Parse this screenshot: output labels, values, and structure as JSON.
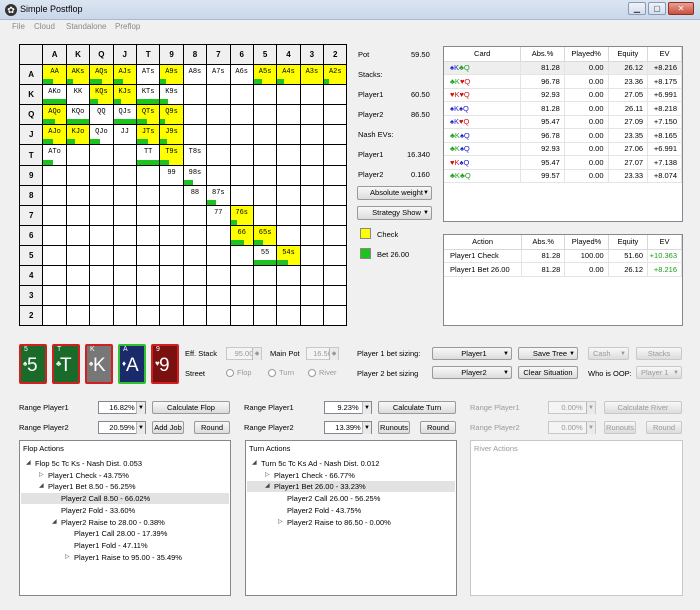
{
  "window": {
    "title": "Simple Postflop"
  },
  "menu": [
    "File",
    "Cloud",
    "Standalone",
    "Preflop"
  ],
  "ranks": [
    "A",
    "K",
    "Q",
    "J",
    "T",
    "9",
    "8",
    "7",
    "6",
    "5",
    "4",
    "3",
    "2"
  ],
  "cells": [
    {
      "r": 0,
      "c": 0,
      "t": "AA",
      "y": 1,
      "g": 0.45
    },
    {
      "r": 0,
      "c": 1,
      "t": "AKs",
      "y": 1,
      "g": 0.3
    },
    {
      "r": 0,
      "c": 2,
      "t": "AQs",
      "y": 1,
      "g": 0.55
    },
    {
      "r": 0,
      "c": 3,
      "t": "AJs",
      "y": 1,
      "g": 0.4
    },
    {
      "r": 0,
      "c": 4,
      "t": "ATs",
      "y": 0,
      "g": 0
    },
    {
      "r": 0,
      "c": 5,
      "t": "A9s",
      "y": 1,
      "g": 0.25
    },
    {
      "r": 0,
      "c": 6,
      "t": "A8s",
      "y": 0,
      "g": 0
    },
    {
      "r": 0,
      "c": 7,
      "t": "A7s",
      "y": 0,
      "g": 0
    },
    {
      "r": 0,
      "c": 8,
      "t": "A6s",
      "y": 0,
      "g": 0
    },
    {
      "r": 0,
      "c": 9,
      "t": "A5s",
      "y": 1,
      "g": 0.35
    },
    {
      "r": 0,
      "c": 10,
      "t": "A4s",
      "y": 1,
      "g": 0.3
    },
    {
      "r": 0,
      "c": 11,
      "t": "A3s",
      "y": 1,
      "g": 0
    },
    {
      "r": 0,
      "c": 12,
      "t": "A2s",
      "y": 1,
      "g": 0.2
    },
    {
      "r": 1,
      "c": 0,
      "t": "AKo",
      "y": 0,
      "g": 1
    },
    {
      "r": 1,
      "c": 1,
      "t": "KK",
      "y": 0,
      "g": 0
    },
    {
      "r": 1,
      "c": 2,
      "t": "KQs",
      "y": 1,
      "g": 0.35
    },
    {
      "r": 1,
      "c": 3,
      "t": "KJs",
      "y": 1,
      "g": 0.35
    },
    {
      "r": 1,
      "c": 4,
      "t": "KTs",
      "y": 0,
      "g": 1
    },
    {
      "r": 1,
      "c": 5,
      "t": "K9s",
      "y": 0,
      "g": 0.35
    },
    {
      "r": 2,
      "c": 0,
      "t": "AQo",
      "y": 1,
      "g": 0.5
    },
    {
      "r": 2,
      "c": 1,
      "t": "KQo",
      "y": 0,
      "g": 1
    },
    {
      "r": 2,
      "c": 2,
      "t": "QQ",
      "y": 0,
      "g": 0
    },
    {
      "r": 2,
      "c": 3,
      "t": "QJs",
      "y": 0,
      "g": 1
    },
    {
      "r": 2,
      "c": 4,
      "t": "QTs",
      "y": 1,
      "g": 0.45
    },
    {
      "r": 2,
      "c": 5,
      "t": "Q9s",
      "y": 1,
      "g": 0.2
    },
    {
      "r": 3,
      "c": 0,
      "t": "AJo",
      "y": 1,
      "g": 0.45
    },
    {
      "r": 3,
      "c": 1,
      "t": "KJo",
      "y": 1,
      "g": 0.35
    },
    {
      "r": 3,
      "c": 2,
      "t": "QJo",
      "y": 0,
      "g": 0.45
    },
    {
      "r": 3,
      "c": 3,
      "t": "JJ",
      "y": 0,
      "g": 0
    },
    {
      "r": 3,
      "c": 4,
      "t": "JTs",
      "y": 1,
      "g": 0.5
    },
    {
      "r": 3,
      "c": 5,
      "t": "J9s",
      "y": 1,
      "g": 0.3
    },
    {
      "r": 4,
      "c": 0,
      "t": "ATo",
      "y": 0,
      "g": 0.45
    },
    {
      "r": 4,
      "c": 4,
      "t": "TT",
      "y": 0,
      "g": 1
    },
    {
      "r": 4,
      "c": 5,
      "t": "T9s",
      "y": 1,
      "g": 0.4
    },
    {
      "r": 4,
      "c": 6,
      "t": "T8s",
      "y": 0,
      "g": 0
    },
    {
      "r": 5,
      "c": 5,
      "t": "99",
      "y": 0,
      "g": 0
    },
    {
      "r": 5,
      "c": 6,
      "t": "98s",
      "y": 0,
      "g": 0.4
    },
    {
      "r": 6,
      "c": 6,
      "t": "88",
      "y": 0,
      "g": 0
    },
    {
      "r": 6,
      "c": 7,
      "t": "87s",
      "y": 0,
      "g": 0.4
    },
    {
      "r": 7,
      "c": 7,
      "t": "77",
      "y": 0,
      "g": 0
    },
    {
      "r": 7,
      "c": 8,
      "t": "76s",
      "y": 1,
      "g": 0.3
    },
    {
      "r": 8,
      "c": 8,
      "t": "66",
      "y": 1,
      "g": 0.6
    },
    {
      "r": 8,
      "c": 9,
      "t": "65s",
      "y": 1,
      "g": 0.4
    },
    {
      "r": 9,
      "c": 9,
      "t": "55",
      "y": 0,
      "g": 1
    },
    {
      "r": 9,
      "c": 10,
      "t": "54s",
      "y": 1,
      "g": 0.5
    }
  ],
  "info": {
    "pot_label": "Pot",
    "pot_value": "59.50",
    "stacks_label": "Stacks:",
    "player1_label": "Player1",
    "player1_stack": "60.50",
    "player2_label": "Player2",
    "player2_stack": "86.50",
    "nash_label": "Nash EVs:",
    "player1_ev": "16.340",
    "player2_ev": "0.160",
    "weight_select": "Absolute weight",
    "strategy_select": "Strategy Show",
    "check_legend": "Check",
    "bet_legend": "Bet 26.00",
    "colors": {
      "check": "#ffff00",
      "bet": "#1ec41e"
    }
  },
  "card_table": {
    "headers": [
      "Card",
      "Abs.%",
      "Played%",
      "Equity",
      "EV"
    ],
    "rows": [
      {
        "s1": "♠",
        "c1": "#1a1acc",
        "r1": "K",
        "s2": "♣",
        "c2": "#20a020",
        "r2": "Q",
        "abs": "81.28",
        "played": "0.00",
        "equity": "26.12",
        "ev": "+8.216"
      },
      {
        "s1": "♣",
        "c1": "#20a020",
        "r1": "K",
        "s2": "♥",
        "c2": "#d01010",
        "r2": "Q",
        "abs": "96.78",
        "played": "0.00",
        "equity": "23.36",
        "ev": "+8.175"
      },
      {
        "s1": "♥",
        "c1": "#d01010",
        "r1": "K",
        "s2": "♥",
        "c2": "#d01010",
        "r2": "Q",
        "abs": "92.93",
        "played": "0.00",
        "equity": "27.05",
        "ev": "+6.991"
      },
      {
        "s1": "♠",
        "c1": "#1a1acc",
        "r1": "K",
        "s2": "♠",
        "c2": "#1a1acc",
        "r2": "Q",
        "abs": "81.28",
        "played": "0.00",
        "equity": "26.11",
        "ev": "+8.218"
      },
      {
        "s1": "♠",
        "c1": "#1a1acc",
        "r1": "K",
        "s2": "♥",
        "c2": "#d01010",
        "r2": "Q",
        "abs": "95.47",
        "played": "0.00",
        "equity": "27.09",
        "ev": "+7.150"
      },
      {
        "s1": "♣",
        "c1": "#20a020",
        "r1": "K",
        "s2": "♠",
        "c2": "#1a1acc",
        "r2": "Q",
        "abs": "96.78",
        "played": "0.00",
        "equity": "23.35",
        "ev": "+8.165"
      },
      {
        "s1": "♣",
        "c1": "#20a020",
        "r1": "K",
        "s2": "♠",
        "c2": "#1a1acc",
        "r2": "Q",
        "abs": "92.93",
        "played": "0.00",
        "equity": "27.06",
        "ev": "+6.991"
      },
      {
        "s1": "♥",
        "c1": "#d01010",
        "r1": "K",
        "s2": "♠",
        "c2": "#1a1acc",
        "r2": "Q",
        "abs": "95.47",
        "played": "0.00",
        "equity": "27.07",
        "ev": "+7.138"
      },
      {
        "s1": "♣",
        "c1": "#20a020",
        "r1": "K",
        "s2": "♣",
        "c2": "#20a020",
        "r2": "Q",
        "abs": "99.57",
        "played": "0.00",
        "equity": "23.33",
        "ev": "+8.074"
      }
    ]
  },
  "action_table": {
    "headers": [
      "Action",
      "Abs.%",
      "Played%",
      "Equity",
      "EV"
    ],
    "rows": [
      {
        "action": "Player1 Check",
        "abs": "81.28",
        "played": "100.00",
        "equity": "51.60",
        "ev": "+10.363"
      },
      {
        "action": "Player1 Bet 26.00",
        "abs": "81.28",
        "played": "0.00",
        "equity": "26.12",
        "ev": "+8.216"
      }
    ]
  },
  "board": [
    {
      "rank": "5",
      "suit": "♠",
      "big": "5",
      "color": "#1a6b2a"
    },
    {
      "rank": "T",
      "suit": "♣",
      "big": "T",
      "color": "#1a6b2a"
    },
    {
      "rank": "K",
      "suit": "♠",
      "big": "K",
      "color": "#777777"
    },
    {
      "rank": "A",
      "suit": "♦",
      "big": "A",
      "color": "#1a2a6b"
    },
    {
      "rank": "9",
      "suit": "♥",
      "big": "9",
      "color": "#7a1010"
    }
  ],
  "controls": {
    "eff_stack_label": "Eff. Stack",
    "eff_stack": "95.00",
    "main_pot_label": "Main Pot",
    "main_pot": "16.50",
    "street_label": "Street",
    "streets": [
      "Flop",
      "Turn",
      "River"
    ],
    "p1_bet_label": "Player 1 bet sizing:",
    "p1_bet": "Player1",
    "p2_bet_label": "Player 2 bet sizing",
    "p2_bet": "Player2",
    "save_tree": "Save Tree",
    "clear_situation": "Clear Situation",
    "cash": "Cash",
    "stacks": "Stacks",
    "who_oop_label": "Who is OOP:",
    "who_oop": "Player 1"
  },
  "ranges": {
    "flop": {
      "p1_label": "Range Player1",
      "p1": "16.82%",
      "p2_label": "Range Player2",
      "p2": "20.59%",
      "calc": "Calculate Flop",
      "add_job": "Add Job",
      "round": "Round"
    },
    "turn": {
      "p1_label": "Range Player1",
      "p1": "9.23%",
      "p2_label": "Range Player2",
      "p2": "13.39%",
      "calc": "Calculate Turn",
      "runouts": "Runouts",
      "round": "Round"
    },
    "river": {
      "p1_label": "Range Player1",
      "p1": "0.00%",
      "p2_label": "Range Player2",
      "p2": "0.00%",
      "calc": "Calculate River",
      "runouts": "Runouts",
      "round": "Round"
    }
  },
  "flop_tree": {
    "title": "Flop Actions",
    "items": [
      {
        "indent": 0,
        "arrow": "◢",
        "text": "Flop 5c Tc Ks - Nash Dist. 0.053"
      },
      {
        "indent": 1,
        "arrow": "▷",
        "text": "Player1 Check - 43.75%"
      },
      {
        "indent": 1,
        "arrow": "◢",
        "text": "Player1 Bet 8.50 - 56.25%"
      },
      {
        "indent": 2,
        "arrow": "",
        "text": "Player2 Call 8.50 - 66.02%",
        "sel": true
      },
      {
        "indent": 2,
        "arrow": "",
        "text": "Player2 Fold - 33.60%"
      },
      {
        "indent": 2,
        "arrow": "◢",
        "text": "Player2 Raise to 28.00 - 0.38%"
      },
      {
        "indent": 3,
        "arrow": "",
        "text": "Player1 Call 28.00 - 17.39%"
      },
      {
        "indent": 3,
        "arrow": "",
        "text": "Player1 Fold - 47.11%"
      },
      {
        "indent": 3,
        "arrow": "▷",
        "text": "Player1 Raise to 95.00 - 35.49%"
      }
    ]
  },
  "turn_tree": {
    "title": "Turn Actions",
    "items": [
      {
        "indent": 0,
        "arrow": "◢",
        "text": "Turn 5c Tc Ks Ad - Nash Dist. 0.012"
      },
      {
        "indent": 1,
        "arrow": "▷",
        "text": "Player1 Check - 66.77%"
      },
      {
        "indent": 1,
        "arrow": "◢",
        "text": "Player1 Bet 26.00 - 33.23%",
        "sel": true
      },
      {
        "indent": 2,
        "arrow": "",
        "text": "Player2 Call 26.00 - 56.25%"
      },
      {
        "indent": 2,
        "arrow": "",
        "text": "Player2 Fold - 43.75%"
      },
      {
        "indent": 2,
        "arrow": "▷",
        "text": "Player2 Raise to 86.50 - 0.00%"
      }
    ]
  },
  "river_tree": {
    "title": "River Actions"
  }
}
